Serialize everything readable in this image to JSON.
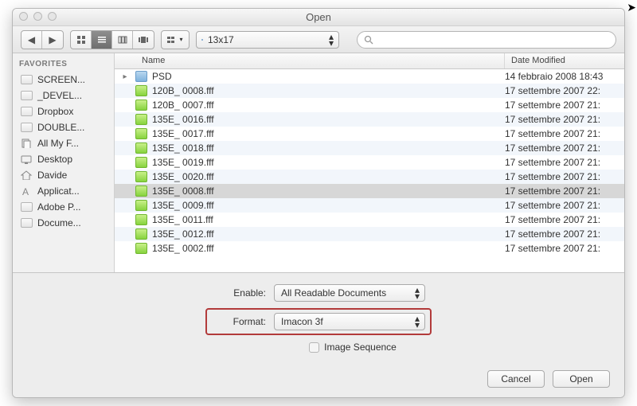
{
  "window": {
    "title": "Open"
  },
  "toolbar": {
    "path_label": "13x17",
    "search_placeholder": ""
  },
  "sidebar": {
    "heading": "FAVORITES",
    "items": [
      {
        "label": "SCREEN...",
        "icon": "folder"
      },
      {
        "label": "_DEVEL...",
        "icon": "folder"
      },
      {
        "label": "Dropbox",
        "icon": "folder"
      },
      {
        "label": "DOUBLE...",
        "icon": "folder"
      },
      {
        "label": "All My F...",
        "icon": "allfiles"
      },
      {
        "label": "Desktop",
        "icon": "desktop"
      },
      {
        "label": "Davide",
        "icon": "home"
      },
      {
        "label": "Applicat...",
        "icon": "apps"
      },
      {
        "label": "Adobe P...",
        "icon": "folder"
      },
      {
        "label": "Docume...",
        "icon": "folder"
      }
    ]
  },
  "columns": {
    "name": "Name",
    "date": "Date Modified"
  },
  "files": [
    {
      "name": "PSD",
      "date": "14 febbraio 2008 18:43",
      "kind": "folder",
      "disclosure": true,
      "selected": false
    },
    {
      "name": "120B_ 0008.fff",
      "date": "17 settembre 2007 22:",
      "kind": "fff",
      "selected": false
    },
    {
      "name": "120B_ 0007.fff",
      "date": "17 settembre 2007 21:",
      "kind": "fff",
      "selected": false
    },
    {
      "name": "135E_ 0016.fff",
      "date": "17 settembre 2007 21:",
      "kind": "fff",
      "selected": false
    },
    {
      "name": "135E_ 0017.fff",
      "date": "17 settembre 2007 21:",
      "kind": "fff",
      "selected": false
    },
    {
      "name": "135E_ 0018.fff",
      "date": "17 settembre 2007 21:",
      "kind": "fff",
      "selected": false
    },
    {
      "name": "135E_ 0019.fff",
      "date": "17 settembre 2007 21:",
      "kind": "fff",
      "selected": false
    },
    {
      "name": "135E_ 0020.fff",
      "date": "17 settembre 2007 21:",
      "kind": "fff",
      "selected": false
    },
    {
      "name": "135E_ 0008.fff",
      "date": "17 settembre 2007 21:",
      "kind": "fff",
      "selected": true
    },
    {
      "name": "135E_ 0009.fff",
      "date": "17 settembre 2007 21:",
      "kind": "fff",
      "selected": false
    },
    {
      "name": "135E_ 0011.fff",
      "date": "17 settembre 2007 21:",
      "kind": "fff",
      "selected": false
    },
    {
      "name": "135E_ 0012.fff",
      "date": "17 settembre 2007 21:",
      "kind": "fff",
      "selected": false
    },
    {
      "name": "135E_ 0002.fff",
      "date": "17 settembre 2007 21:",
      "kind": "fff",
      "selected": false
    }
  ],
  "options": {
    "enable_label": "Enable:",
    "enable_value": "All Readable Documents",
    "format_label": "Format:",
    "format_value": "Imacon 3f",
    "image_sequence_label": "Image Sequence"
  },
  "buttons": {
    "cancel": "Cancel",
    "open": "Open"
  }
}
